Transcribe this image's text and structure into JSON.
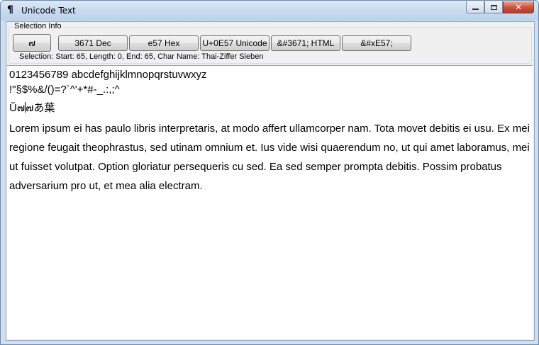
{
  "window": {
    "title": "Unicode Text",
    "icon_glyph": "¶",
    "controls": {
      "close_label": "✕"
    }
  },
  "selection_info": {
    "group_label": "Selection Info",
    "char_preview": "๗",
    "buttons": [
      {
        "label": "3671 Dec"
      },
      {
        "label": "e57 Hex"
      },
      {
        "label": "U+0E57 Unicode"
      },
      {
        "label": "&#3671; HTML"
      },
      {
        "label": "&#xE57;"
      }
    ],
    "status": "Selection: Start: 65, Length: 0, End: 65, Char Name: Thai-Ziffer Sieben"
  },
  "editor": {
    "line1": "0123456789 abcdefghijklmnopqrstuvwxyz",
    "line2": "!\"§$%&/()=?`^'+*#-_.:,;^",
    "line3_before": "Ŭ๗",
    "line3_after": "๗あ葉",
    "paragraph": "Lorem ipsum ei has paulo libris interpretaris, at modo affert ullamcorper nam. Tota movet debitis ei usu. Ex mei regione feugait theophrastus, sed utinam omnium et. Ius vide wisi quaerendum no, ut qui amet laboramus, mei ut fuisset volutpat. Option gloriatur persequeris cu sed. Ea sed semper prompta debitis. Possim probatus adversarium pro ut, et mea alia electram."
  }
}
